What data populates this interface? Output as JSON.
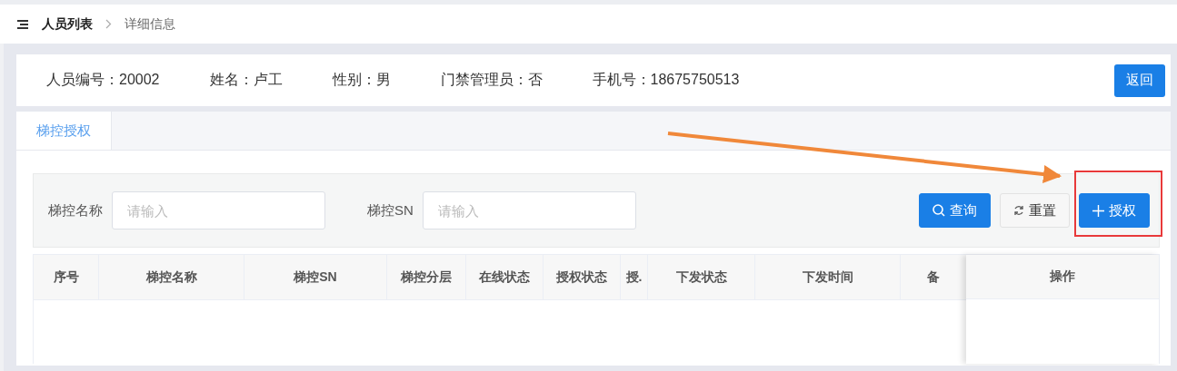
{
  "breadcrumb": {
    "items": [
      {
        "label": "人员列表",
        "selected": true
      },
      {
        "label": "详细信息",
        "selected": false
      }
    ]
  },
  "person_info": {
    "fields": [
      {
        "label": "人员编号：20002"
      },
      {
        "label": "姓名：卢工"
      },
      {
        "label": "性别：男"
      },
      {
        "label": "门禁管理员：否"
      },
      {
        "label": "手机号：18675750513"
      }
    ],
    "back_button": "返回"
  },
  "tabs": [
    {
      "label": "梯控授权",
      "selected": true
    }
  ],
  "filters": [
    {
      "label": "梯控名称",
      "placeholder": "请输入"
    },
    {
      "label": "梯控SN",
      "placeholder": "请输入"
    }
  ],
  "buttons": [
    {
      "kind": "search",
      "label": "查询"
    },
    {
      "kind": "reset",
      "label": "重置"
    },
    {
      "kind": "add",
      "label": "授权"
    }
  ],
  "table": {
    "columns": [
      "序号",
      "梯控名称",
      "梯控SN",
      "梯控分层",
      "在线状态",
      "授权状态",
      "授.",
      "下发状态",
      "下发时间",
      "备"
    ],
    "fixed_column": "操作"
  }
}
